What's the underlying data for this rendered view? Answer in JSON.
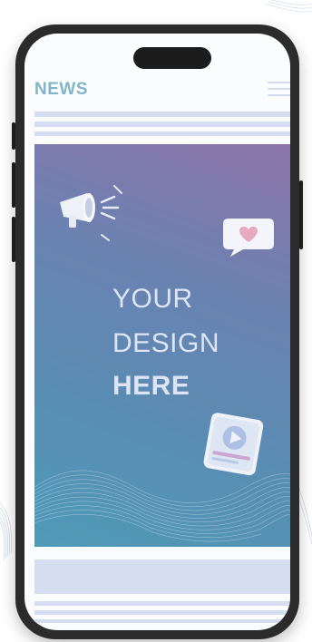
{
  "app": {
    "title": "NEWS"
  },
  "header": {
    "menu_icon": "hamburger-menu-icon"
  },
  "hero": {
    "headline_line1": "YOUR",
    "headline_line2": "DESIGN",
    "headline_line3": "HERE",
    "icons": [
      "megaphone-icon",
      "heart-chat-bubble-icon",
      "video-play-card-icon"
    ]
  },
  "colors": {
    "news_title": "#7fb6c9",
    "placeholder_bars": "#d7ddf1",
    "hero_gradient_top": "#8d74a8",
    "hero_gradient_bottom": "#4f9ab8",
    "headline_text": "#dde4f3",
    "device_frame": "#2b2b2b"
  }
}
